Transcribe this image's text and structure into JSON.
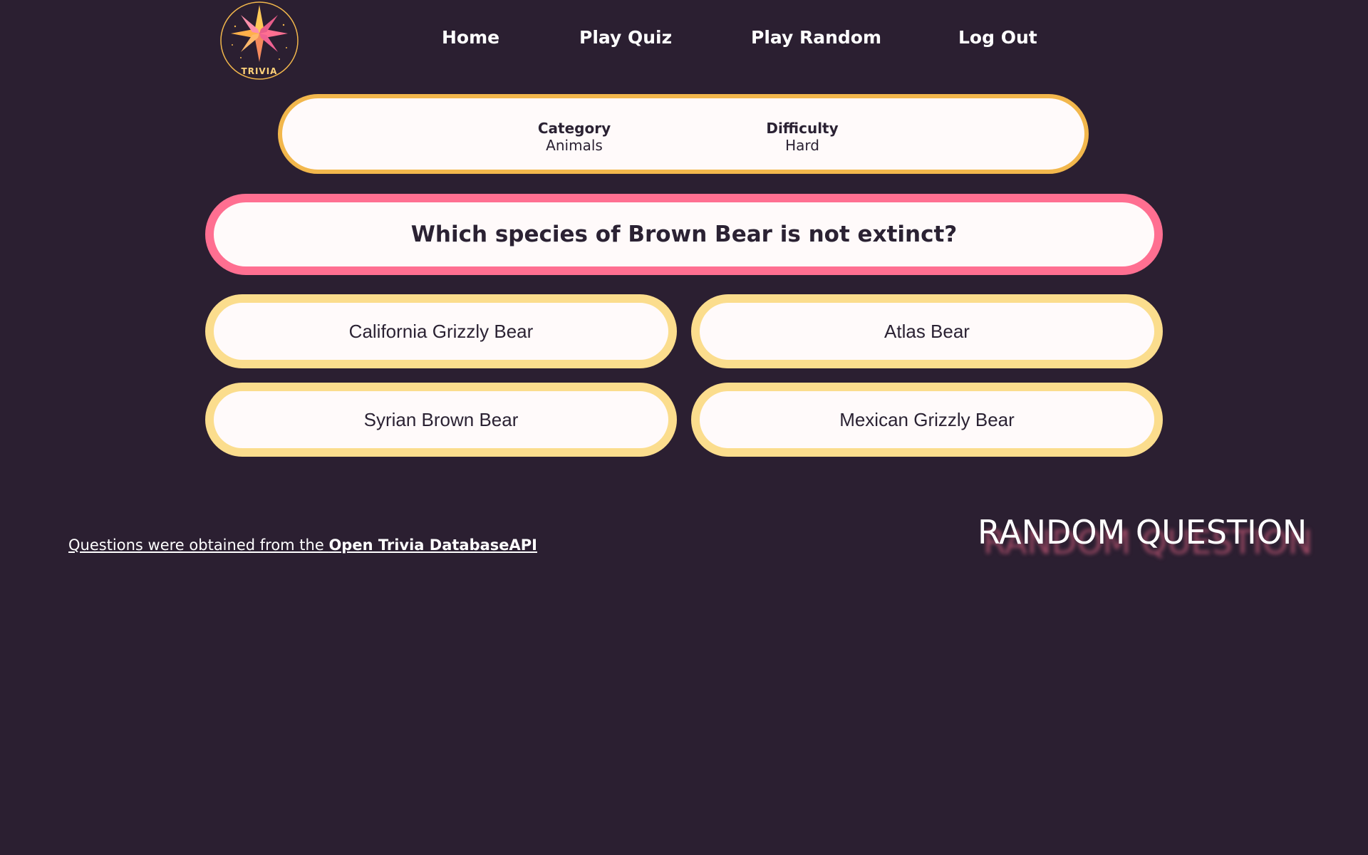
{
  "logo": {
    "text": "TRIVIA",
    "icon": "compass-star-icon"
  },
  "nav": {
    "home": "Home",
    "play_quiz": "Play Quiz",
    "play_random": "Play Random",
    "log_out": "Log Out"
  },
  "info": {
    "category_label": "Category",
    "category_value": "Animals",
    "difficulty_label": "Difficulty",
    "difficulty_value": "Hard"
  },
  "question": "Which species of Brown Bear is not extinct?",
  "answers": [
    "California Grizzly Bear",
    "Atlas Bear",
    "Syrian Brown Bear",
    "Mexican Grizzly Bear"
  ],
  "footer": {
    "credit_prefix": "Questions were obtained from the ",
    "credit_link": "Open Trivia DatabaseAPI"
  },
  "page_heading": "RANDOM QUESTION",
  "colors": {
    "background": "#2b1f31",
    "info_border": "#f2b74c",
    "question_border": "#ff6f91",
    "answer_border": "#fbdd8d",
    "card_fill": "#fffafa"
  }
}
